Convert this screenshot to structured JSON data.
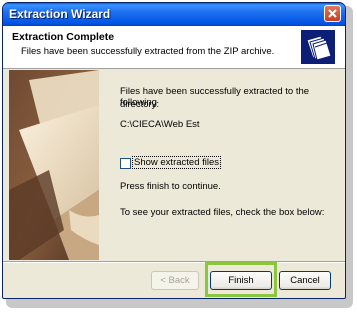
{
  "window": {
    "title": "Extraction Wizard"
  },
  "header": {
    "title": "Extraction Complete",
    "subtitle": "Files have been successfully extracted from the ZIP archive."
  },
  "content": {
    "line1": "Files have been successfully extracted to the following",
    "line2": "directory:",
    "path": "C:\\CIECA\\Web Est",
    "instruction": "To see your extracted files, check the box below:",
    "checkbox_label": "Show extracted files",
    "checkbox_checked": false,
    "finish_note": "Press finish to continue."
  },
  "buttons": {
    "back": "< Back",
    "finish": "Finish",
    "cancel": "Cancel"
  },
  "colors": {
    "highlight": "#8cc63f",
    "titlebar": "#0055e5"
  }
}
